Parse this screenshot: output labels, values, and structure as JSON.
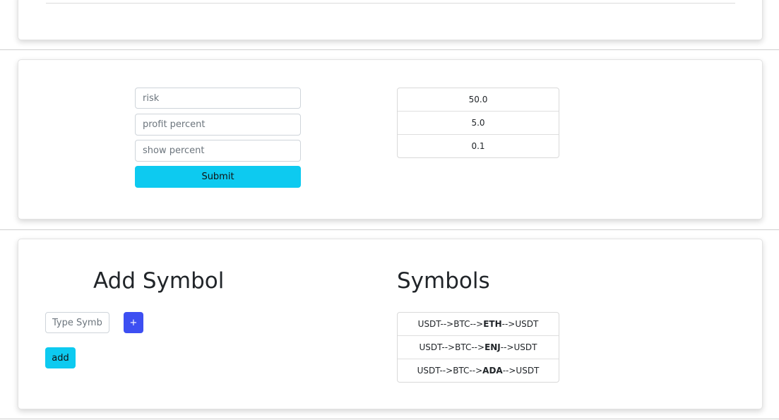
{
  "settings_form": {
    "risk_placeholder": "risk",
    "profit_placeholder": "profit percent",
    "show_placeholder": "show percent",
    "submit_label": "Submit"
  },
  "current_values": [
    "50.0",
    "5.0",
    "0.1"
  ],
  "add_symbol": {
    "heading": "Add Symbol",
    "input_placeholder": "Type Symbol",
    "plus_label": "+",
    "add_label": "add"
  },
  "symbols": {
    "heading": "Symbols",
    "items": [
      {
        "prefix": "USDT-->BTC-->",
        "symbol": "ETH",
        "suffix": "-->USDT"
      },
      {
        "prefix": "USDT-->BTC-->",
        "symbol": "ENJ",
        "suffix": "-->USDT"
      },
      {
        "prefix": "USDT-->BTC-->",
        "symbol": "ADA",
        "suffix": "-->USDT"
      }
    ]
  },
  "colors": {
    "info_button": "#0dcaf0",
    "primary_button": "#3d4ff2"
  }
}
